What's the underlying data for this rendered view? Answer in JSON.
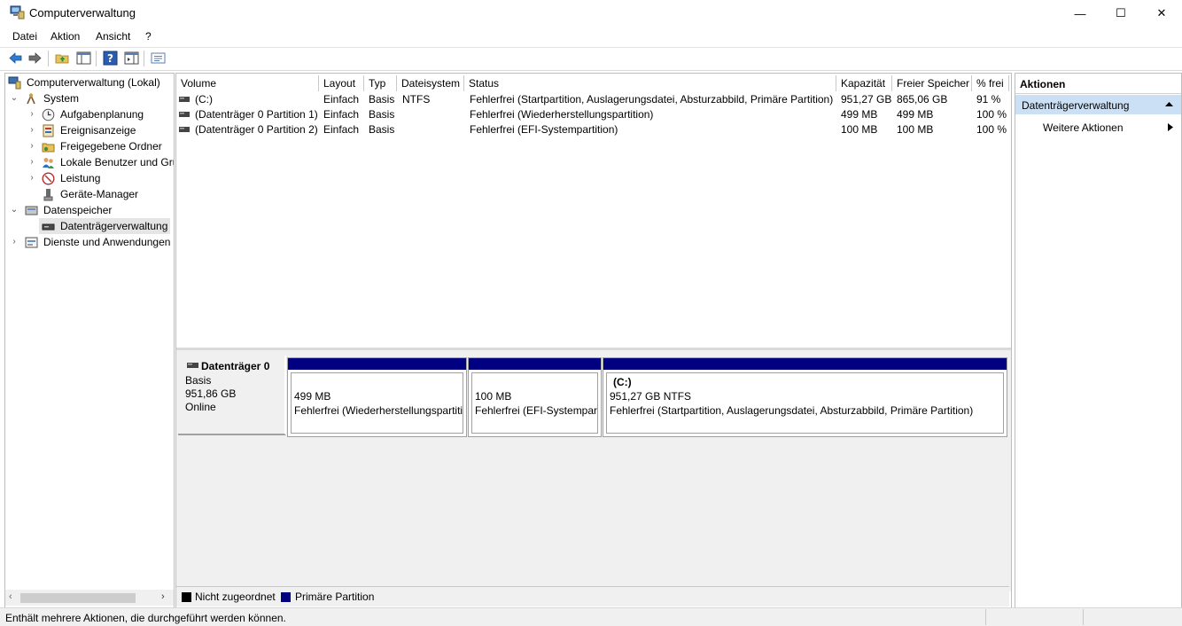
{
  "window": {
    "title": "Computerverwaltung",
    "minimize_glyph": "—",
    "maximize_glyph": "☐",
    "close_glyph": "✕"
  },
  "menu": {
    "items": [
      "Datei",
      "Aktion",
      "Ansicht",
      "?"
    ]
  },
  "tree": {
    "root": "Computerverwaltung (Lokal)",
    "system": "System",
    "aufgaben": "Aufgabenplanung",
    "ereignis": "Ereignisanzeige",
    "freigabe": "Freigegebene Ordner",
    "benutzer": "Lokale Benutzer und Gruppen",
    "leistung": "Leistung",
    "geraete": "Geräte-Manager",
    "datenspeicher": "Datenspeicher",
    "dtv": "Datenträgerverwaltung",
    "dienste": "Dienste und Anwendungen"
  },
  "volume_table": {
    "headers": [
      "Volume",
      "Layout",
      "Typ",
      "Dateisystem",
      "Status",
      "Kapazität",
      "Freier Speicher",
      "% frei"
    ],
    "rows": [
      [
        "(C:)",
        "Einfach",
        "Basis",
        "NTFS",
        "Fehlerfrei (Startpartition, Auslagerungsdatei, Absturzabbild, Primäre Partition)",
        "951,27 GB",
        "865,06 GB",
        "91 %"
      ],
      [
        "(Datenträger 0 Partition 1)",
        "Einfach",
        "Basis",
        "",
        "Fehlerfrei (Wiederherstellungspartition)",
        "499 MB",
        "499 MB",
        "100 %"
      ],
      [
        "(Datenträger 0 Partition 2)",
        "Einfach",
        "Basis",
        "",
        "Fehlerfrei (EFI-Systempartition)",
        "100 MB",
        "100 MB",
        "100 %"
      ]
    ]
  },
  "disk": {
    "name": "Datenträger 0",
    "type": "Basis",
    "size": "951,86 GB",
    "state": "Online",
    "partitions": [
      {
        "title": "",
        "size": "499 MB",
        "status": "Fehlerfrei (Wiederherstellungspartition)"
      },
      {
        "title": "",
        "size": "100 MB",
        "status": "Fehlerfrei (EFI-Systempartition)"
      },
      {
        "title": "(C:)",
        "size": "951,27 GB NTFS",
        "status": "Fehlerfrei (Startpartition, Auslagerungsdatei, Absturzabbild, Primäre Partition)"
      }
    ]
  },
  "legend": {
    "unallocated": "Nicht zugeordnet",
    "primary": "Primäre Partition"
  },
  "colors": {
    "primary_partition": "#000080",
    "unallocated": "#000000",
    "actions_selected": "#cce0f5"
  },
  "actions": {
    "header": "Aktionen",
    "section": "Datenträgerverwaltung",
    "more": "Weitere Aktionen"
  },
  "status": {
    "text": "Enthält mehrere Aktionen, die durchgeführt werden können."
  }
}
